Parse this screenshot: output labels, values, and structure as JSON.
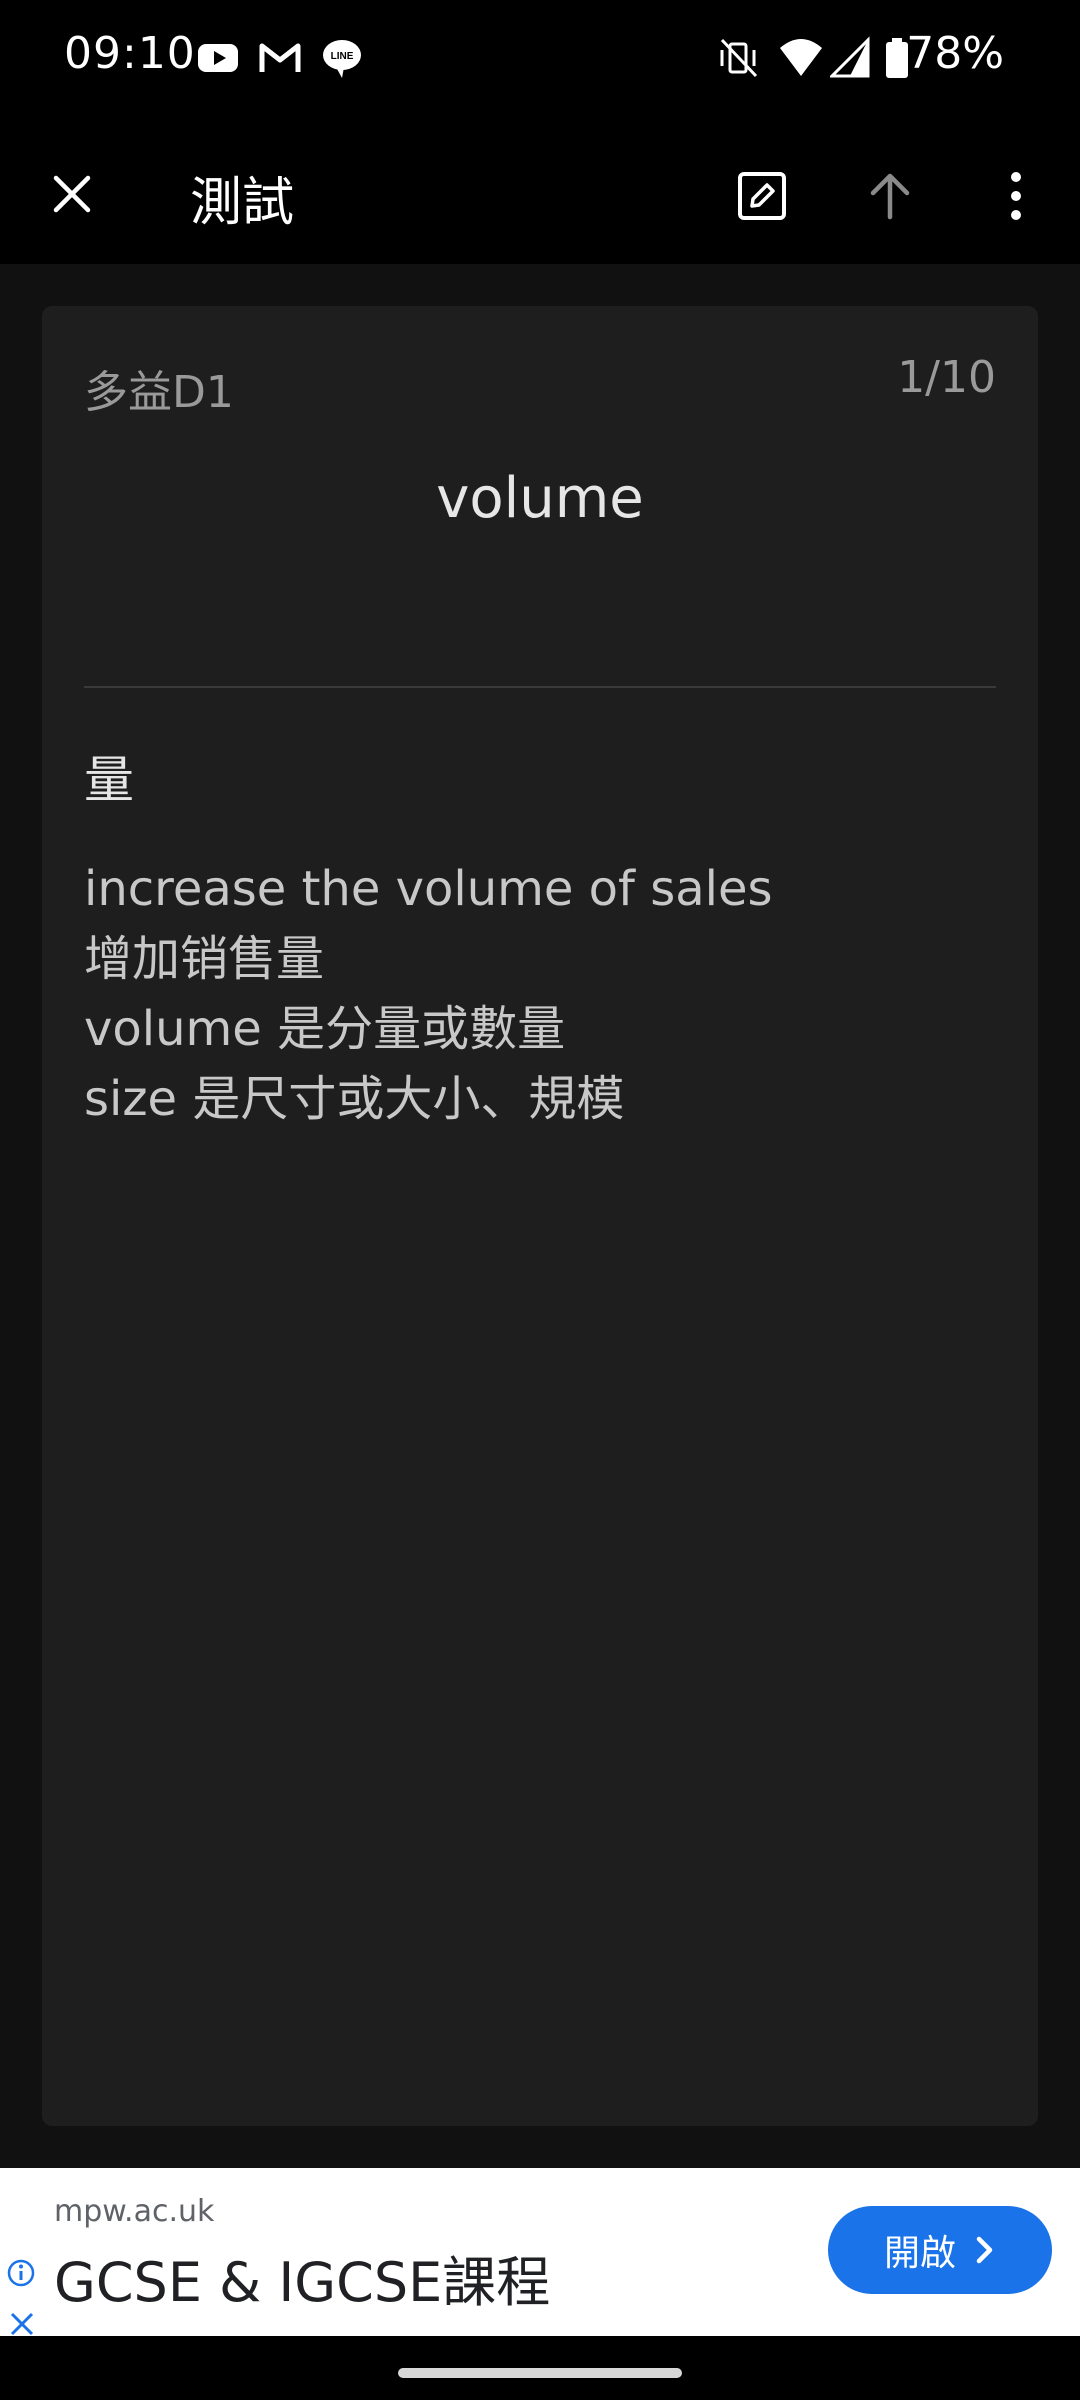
{
  "status_bar": {
    "time": "09:10",
    "battery_percent": "78%",
    "notification_icons": [
      "youtube-icon",
      "gmail-icon",
      "line-icon"
    ],
    "system_icons": [
      "vibrate-off-icon",
      "wifi-icon",
      "signal-icon",
      "battery-icon"
    ]
  },
  "app_bar": {
    "title": "測試",
    "close_icon": "close-icon",
    "edit_icon": "edit-icon",
    "up_icon": "arrow-up-icon",
    "menu_icon": "more-vert-icon"
  },
  "card": {
    "deck_name": "多益D1",
    "counter": "1/10",
    "front": "volume",
    "back_main": "量",
    "notes": [
      "increase the volume of sales",
      "增加销售量",
      "volume 是分量或數量",
      "size 是尺寸或大小、規模"
    ]
  },
  "ad": {
    "domain": "mpw.ac.uk",
    "title": "GCSE & IGCSE課程",
    "button_label": "開啟",
    "accent_color": "#1a73e8"
  }
}
